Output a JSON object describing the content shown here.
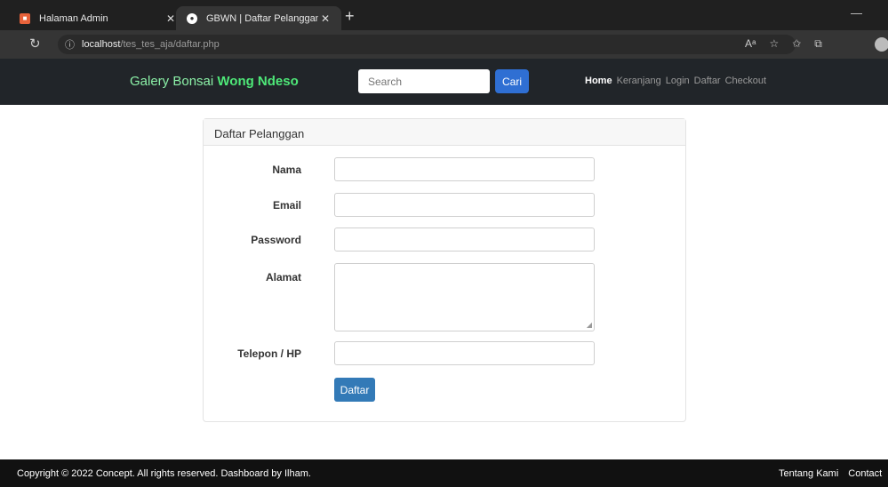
{
  "browser": {
    "tabs": [
      {
        "title": "Halaman Admin",
        "icon": "admin-page-icon"
      },
      {
        "title": "GBWN | Daftar Pelanggan",
        "icon": "site-icon"
      }
    ],
    "address": {
      "host": "localhost",
      "path": "/tes_tes_aja/daftar.php"
    }
  },
  "navbar": {
    "brand_prefix": "Galery Bonsai ",
    "brand_strong": "Wong Ndeso",
    "search_placeholder": "Search",
    "search_button": "Cari",
    "links": [
      "Home",
      "Keranjang",
      "Login",
      "Daftar",
      "Checkout"
    ]
  },
  "form": {
    "title": "Daftar Pelanggan",
    "labels": {
      "nama": "Nama",
      "email": "Email",
      "password": "Password",
      "alamat": "Alamat",
      "telepon": "Telepon / HP"
    },
    "submit": "Daftar"
  },
  "footer": {
    "copyright": "Copyright © 2022 Concept. All rights reserved. Dashboard by   Ilham.",
    "links": [
      "Tentang Kami",
      "Contact"
    ]
  }
}
